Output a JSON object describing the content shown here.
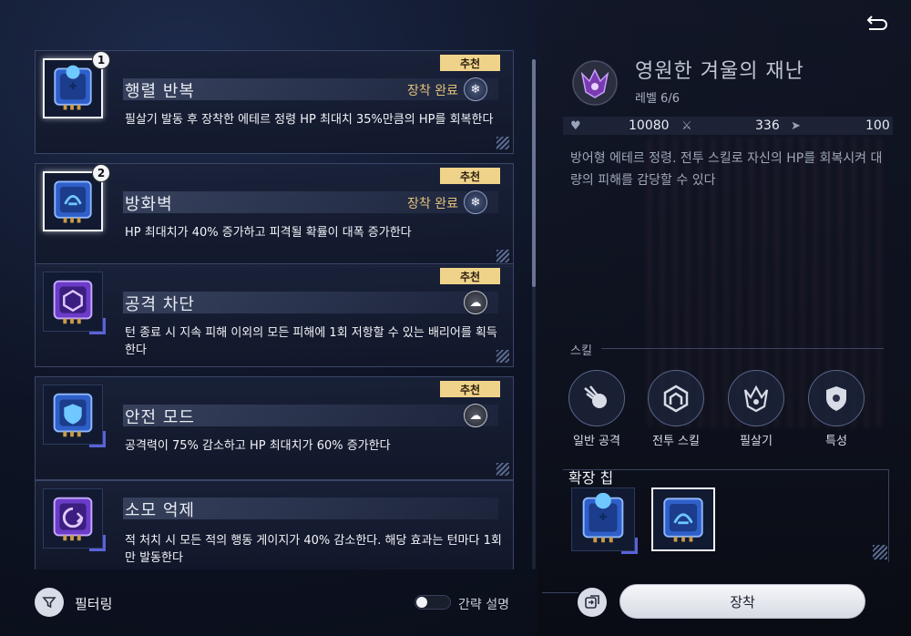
{
  "back_label": "",
  "cards": [
    {
      "badge": "추천",
      "title": "행렬 반복",
      "status": "장착 완료",
      "desc": "필살기 발동 후 장착한 에테르 정령 HP 최대치 35%만큼의 HP를 회복한다",
      "slot_number": "1",
      "chip_color": "#3a6fd8",
      "emblem_icon": "blue-spirit-icon"
    },
    {
      "badge": "추천",
      "title": "방화벽",
      "status": "장착 완료",
      "desc": "HP 최대치가 40% 증가하고 피격될 확률이 대폭 증가한다",
      "slot_number": "2",
      "chip_color": "#3a6fd8",
      "emblem_icon": "blue-spirit-icon"
    },
    {
      "badge": "추천",
      "title": "공격 차단",
      "status": "",
      "desc": "턴 종료 시 지속 피해 이외의 모든 피해에 1회 저항할 수 있는 배리어를 획득한다",
      "slot_number": "",
      "chip_color": "#7a4ad8",
      "emblem_icon": "gray-spirit-icon"
    },
    {
      "badge": "추천",
      "title": "안전 모드",
      "status": "",
      "desc": "공격력이 75% 감소하고 HP 최대치가 60% 증가한다",
      "slot_number": "",
      "chip_color": "#3a6fd8",
      "emblem_icon": "gray-spirit-icon"
    },
    {
      "badge": "",
      "title": "소모 억제",
      "status": "",
      "desc": "적 처치 시 모든 적의 행동 게이지가 40% 감소한다. 해당 효과는 턴마다 1회만 발동한다",
      "slot_number": "",
      "chip_color": "#7a4ad8",
      "emblem_icon": ""
    }
  ],
  "hero": {
    "title": "영원한 겨울의 재난",
    "level": "레벨 6/6",
    "hp": "10080",
    "attack": "336",
    "speed": "100",
    "desc": "방어형 에테르 정령. 전투 스킬로 자신의 HP를 회복시켜 대량의 피해를 감당할 수 있다"
  },
  "skills": {
    "heading": "스킬",
    "items": [
      {
        "label": "일반 공격",
        "icon": "comet-icon"
      },
      {
        "label": "전투 스킬",
        "icon": "shield-house-icon"
      },
      {
        "label": "필살기",
        "icon": "beast-crown-icon"
      },
      {
        "label": "특성",
        "icon": "shield-icon"
      }
    ]
  },
  "expansion": {
    "heading": "확장 칩"
  },
  "bottom": {
    "filter_label": "필터링",
    "toggle_label": "간략 설명",
    "equip_label": "장착"
  }
}
